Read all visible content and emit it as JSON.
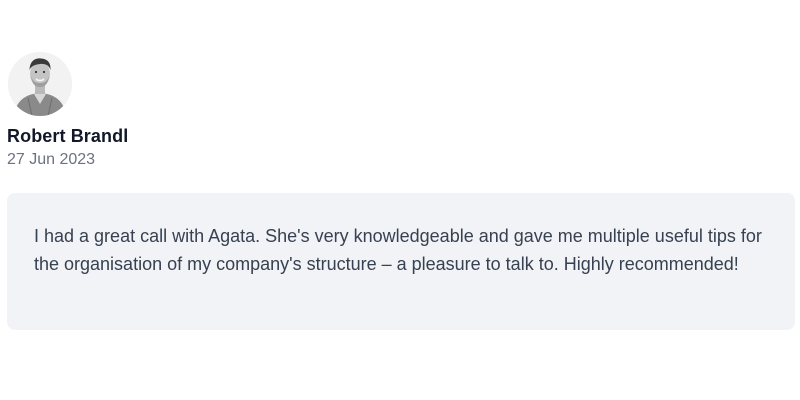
{
  "review": {
    "author_name": "Robert Brandl",
    "date": "27 Jun 2023",
    "text": "I had a great call with Agata. She's very knowledgeable and gave me multiple useful tips for the organisation of my company's structure – a pleasure to talk to. Highly recommended!"
  },
  "colors": {
    "name": "#111827",
    "date": "#6b7280",
    "quote_text": "#374151",
    "quote_background": "#f1f3f6"
  },
  "icons": {
    "avatar": "person-photo"
  }
}
